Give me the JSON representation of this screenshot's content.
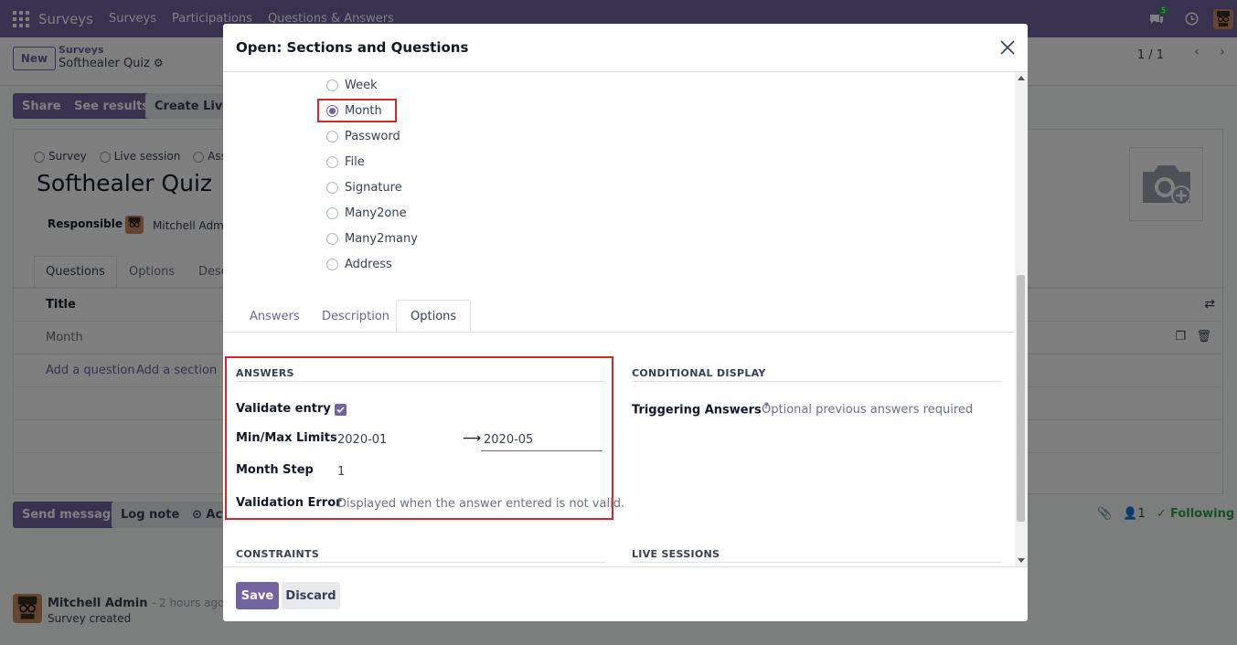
{
  "navbar": {
    "brand": "Surveys",
    "menu": [
      "Surveys",
      "Participations",
      "Questions & Answers"
    ],
    "chat_count": "5"
  },
  "control_panel": {
    "new_label": "New",
    "breadcrumb_parent": "Surveys",
    "breadcrumb_current": "Softhealer Quiz",
    "pager": "1 / 1"
  },
  "form": {
    "buttons": [
      "Share",
      "See results",
      "Create Live S"
    ],
    "survey_types": [
      "Survey",
      "Live session",
      "Asse"
    ],
    "title": "Softhealer Quiz",
    "responsible_label": "Responsible",
    "responsible_value": "Mitchell Admi",
    "tabs": [
      "Questions",
      "Options",
      "Desc"
    ],
    "list_header": "Title",
    "list_row": "Month",
    "add_question": "Add a question",
    "add_section": "Add a section"
  },
  "chatter": {
    "send_message": "Send message",
    "log_note": "Log note",
    "activity": "Act",
    "followers_count": "1",
    "following": "Following",
    "author": "Mitchell Admin",
    "time": "- 2 hours ago",
    "body": "Survey created"
  },
  "modal": {
    "title": "Open: Sections and Questions",
    "question_types": [
      {
        "label": "Week",
        "checked": false
      },
      {
        "label": "Month",
        "checked": true
      },
      {
        "label": "Password",
        "checked": false
      },
      {
        "label": "File",
        "checked": false
      },
      {
        "label": "Signature",
        "checked": false
      },
      {
        "label": "Many2one",
        "checked": false
      },
      {
        "label": "Many2many",
        "checked": false
      },
      {
        "label": "Address",
        "checked": false
      }
    ],
    "tabs": [
      {
        "label": "Answers",
        "active": false
      },
      {
        "label": "Description",
        "active": false
      },
      {
        "label": "Options",
        "active": true
      }
    ],
    "answers_section": {
      "title": "ANSWERS",
      "validate_entry_label": "Validate entry",
      "validate_entry_checked": true,
      "min_max_label": "Min/Max Limits",
      "min_value": "2020-01",
      "max_value": "2020-05",
      "month_step_label": "Month Step",
      "month_step_value": "1",
      "validation_error_label": "Validation Error",
      "validation_error_placeholder": "Displayed when the answer entered is not valid."
    },
    "conditional_section": {
      "title": "CONDITIONAL DISPLAY",
      "triggering_label": "Triggering Answers",
      "triggering_help": "?",
      "triggering_placeholder": "Optional previous answers required"
    },
    "constraints_title": "CONSTRAINTS",
    "live_sessions_title": "LIVE SESSIONS",
    "save_label": "Save",
    "discard_label": "Discard"
  },
  "colors": {
    "brand": "#71639e",
    "highlight": "#dc2626",
    "following": "#28a745"
  }
}
